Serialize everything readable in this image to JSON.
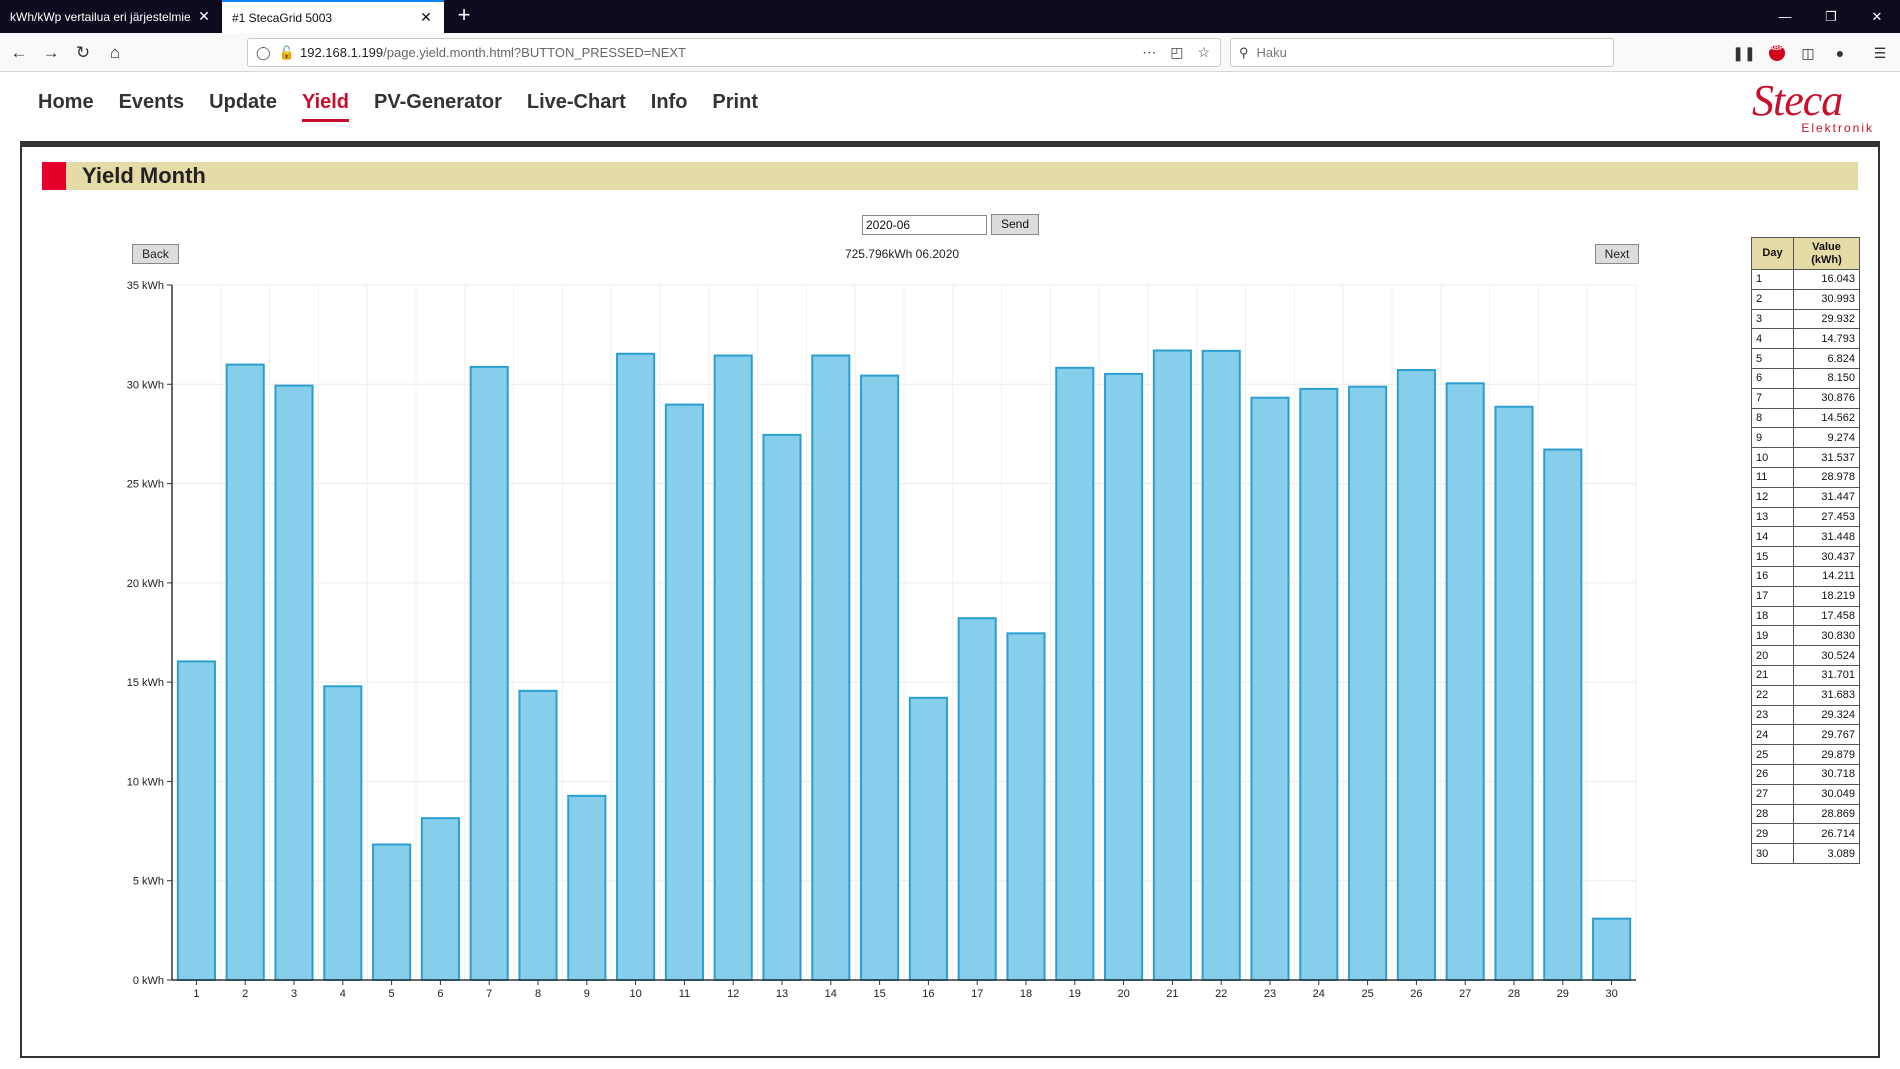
{
  "browser": {
    "tabs": [
      {
        "title": "kWh/kWp vertailua eri järjestelmien",
        "active": false
      },
      {
        "title": "#1 StecaGrid 5003",
        "active": true
      }
    ],
    "url_host": "192.168.1.199",
    "url_path": "/page.yield.month.html?BUTTON_PRESSED=NEXT",
    "search_placeholder": "Haku"
  },
  "menu": [
    {
      "label": "Home",
      "active": false
    },
    {
      "label": "Events",
      "active": false
    },
    {
      "label": "Update",
      "active": false
    },
    {
      "label": "Yield",
      "active": true
    },
    {
      "label": "PV-Generator",
      "active": false
    },
    {
      "label": "Live-Chart",
      "active": false
    },
    {
      "label": "Info",
      "active": false
    },
    {
      "label": "Print",
      "active": false
    }
  ],
  "logo": {
    "word": "Steca",
    "sub": "Elektronik"
  },
  "page_title": "Yield Month",
  "form": {
    "month_value": "2020-06",
    "send_label": "Send"
  },
  "nav": {
    "back_label": "Back",
    "next_label": "Next"
  },
  "total_label": "725.796kWh 06.2020",
  "colors": {
    "bar_fill": "#87ceeb",
    "bar_stroke": "#2a9fd0",
    "title_bar": "#e5dba6",
    "accent": "#c8102e"
  },
  "table": {
    "col_day": "Day",
    "col_value_line1": "Value",
    "col_value_line2": "(kWh)"
  },
  "chart_data": {
    "type": "bar",
    "title": "",
    "xlabel": "",
    "ylabel": "",
    "ylim": [
      0,
      35
    ],
    "y_ticks": [
      "0 kWh",
      "5 kWh",
      "10 kWh",
      "15 kWh",
      "20 kWh",
      "25 kWh",
      "30 kWh",
      "35 kWh"
    ],
    "grid": true,
    "categories": [
      "1",
      "2",
      "3",
      "4",
      "5",
      "6",
      "7",
      "8",
      "9",
      "10",
      "11",
      "12",
      "13",
      "14",
      "15",
      "16",
      "17",
      "18",
      "19",
      "20",
      "21",
      "22",
      "23",
      "24",
      "25",
      "26",
      "27",
      "28",
      "29",
      "30"
    ],
    "values": [
      16.043,
      30.993,
      29.932,
      14.793,
      6.824,
      8.15,
      30.876,
      14.562,
      9.274,
      31.537,
      28.978,
      31.447,
      27.453,
      31.448,
      30.437,
      14.211,
      18.219,
      17.458,
      30.83,
      30.524,
      31.701,
      31.683,
      29.324,
      29.767,
      29.879,
      30.718,
      30.049,
      28.869,
      26.714,
      3.089
    ],
    "value_labels": [
      "16.043",
      "30.993",
      "29.932",
      "14.793",
      "6.824",
      "8.150",
      "30.876",
      "14.562",
      "9.274",
      "31.537",
      "28.978",
      "31.447",
      "27.453",
      "31.448",
      "30.437",
      "14.211",
      "18.219",
      "17.458",
      "30.830",
      "30.524",
      "31.701",
      "31.683",
      "29.324",
      "29.767",
      "29.879",
      "30.718",
      "30.049",
      "28.869",
      "26.714",
      "3.089"
    ]
  }
}
